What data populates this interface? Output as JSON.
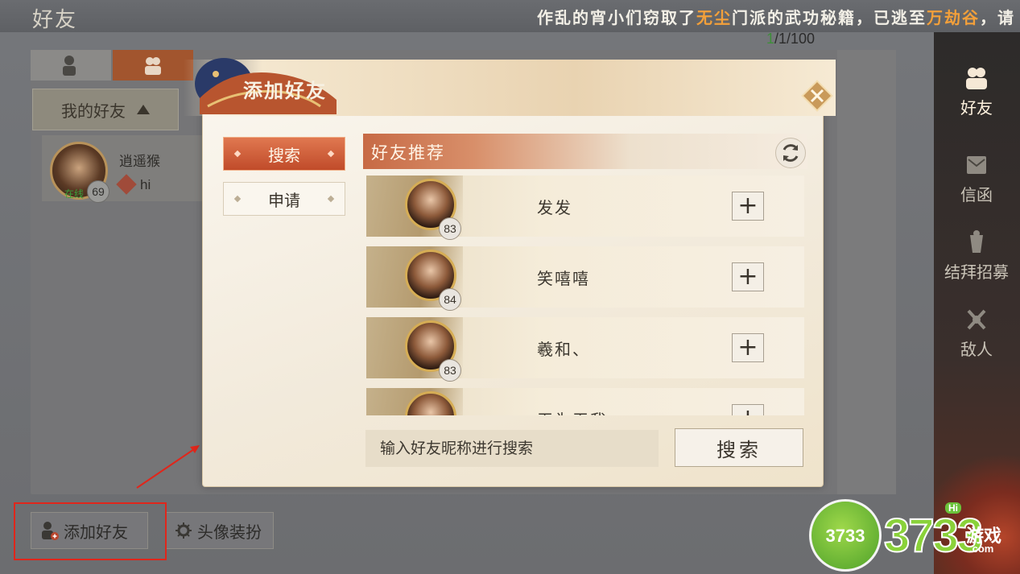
{
  "header": {
    "title": "好友",
    "notice_parts": [
      "作乱的宵小们窃取了",
      "无尘",
      "门派的武功秘籍，已逃至",
      "万劫谷",
      "，请"
    ],
    "counter_current": "1",
    "counter_rest": "/1/100"
  },
  "right_nav": {
    "items": [
      {
        "label": "好友",
        "icon": "friends-icon",
        "active": true
      },
      {
        "label": "信函",
        "icon": "letter-icon",
        "active": false
      },
      {
        "label": "结拜招募",
        "icon": "sworn-recruit-icon",
        "active": false
      },
      {
        "label": "敌人",
        "icon": "enemy-icon",
        "active": false
      }
    ]
  },
  "friends_panel": {
    "group_label": "我的好友",
    "friend": {
      "name": "逍遥猴",
      "level": "69",
      "status": "在线",
      "message": "hi"
    }
  },
  "bottom_buttons": {
    "add_friend": "添加好友",
    "avatar_dress": "头像装扮"
  },
  "dialog": {
    "title": "添加好友",
    "tabs": [
      {
        "label": "搜索",
        "active": true
      },
      {
        "label": "申请",
        "active": false
      }
    ],
    "recommend_title": "好友推荐",
    "recommendations": [
      {
        "name": "发发",
        "level": "83"
      },
      {
        "name": "笑嘻嘻",
        "level": "84"
      },
      {
        "name": "羲和、",
        "level": "83"
      },
      {
        "name": "无为无我",
        "level": ""
      }
    ],
    "search_placeholder": "输入好友昵称进行搜索",
    "search_button": "搜索"
  },
  "watermark": {
    "circle_text": "3733",
    "hi": "Hi",
    "brand": "3733",
    "game": "游戏",
    "domain": ".com"
  },
  "colors": {
    "accent_orange": "#c04b2a",
    "highlight_text": "#f3a03a",
    "annotation_red": "#e0261b"
  }
}
